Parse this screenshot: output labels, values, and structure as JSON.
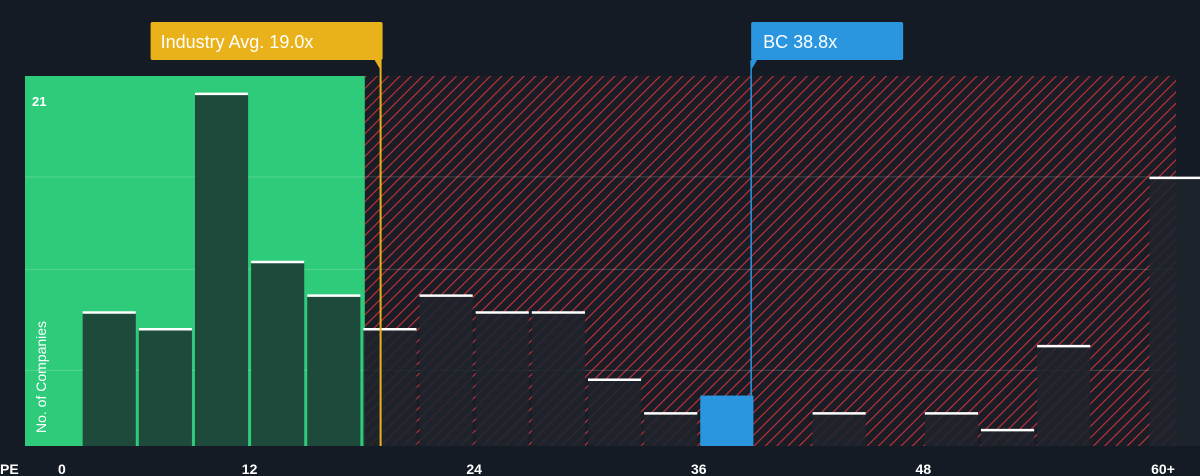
{
  "chart_data": {
    "type": "bar",
    "xlabel": "PE",
    "ylabel": "No. of Companies",
    "x_ticks": [
      "0",
      "12",
      "24",
      "36",
      "48",
      "60+"
    ],
    "x_tick_values": [
      0,
      12,
      24,
      36,
      48,
      60
    ],
    "y_max_label": "21",
    "ylim": [
      0,
      22
    ],
    "xlim": [
      0,
      61.5
    ],
    "bin_width": 3,
    "bins": [
      {
        "start": 3,
        "value": 8
      },
      {
        "start": 6,
        "value": 7
      },
      {
        "start": 9,
        "value": 21
      },
      {
        "start": 12,
        "value": 11
      },
      {
        "start": 15,
        "value": 9
      },
      {
        "start": 18,
        "value": 7
      },
      {
        "start": 21,
        "value": 9
      },
      {
        "start": 24,
        "value": 8
      },
      {
        "start": 27,
        "value": 8
      },
      {
        "start": 30,
        "value": 4
      },
      {
        "start": 33,
        "value": 2
      },
      {
        "start": 36,
        "value": 3,
        "highlight": true
      },
      {
        "start": 42,
        "value": 2
      },
      {
        "start": 48,
        "value": 2
      },
      {
        "start": 51,
        "value": 1
      },
      {
        "start": 54,
        "value": 6
      },
      {
        "start": 60,
        "value": 16
      }
    ],
    "industry_avg": {
      "label": "Industry Avg. 19.0x",
      "value": 19.0
    },
    "company": {
      "label": "BC 38.8x",
      "value": 38.8
    },
    "colors": {
      "background": "#151b24",
      "green_zone": "#2ecc7a",
      "bar_in_green": "#1e4a3c",
      "bar_dark": "#1f242c",
      "bar_top": "#ffffff",
      "hatch": "#c8323c",
      "industry": "#e9b21a",
      "company": "#2b96e0",
      "text": "#ffffff"
    }
  }
}
